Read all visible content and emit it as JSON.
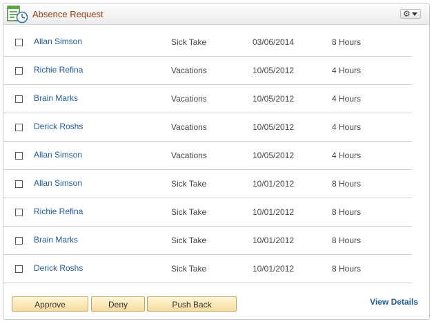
{
  "header": {
    "title": "Absence Request",
    "menu_icon": "gear-icon"
  },
  "rows": [
    {
      "name": "Allan Simson",
      "type": "Sick Take",
      "date": "03/06/2014",
      "hours": "8 Hours"
    },
    {
      "name": "Richie Refina",
      "type": "Vacations",
      "date": "10/05/2012",
      "hours": "4 Hours"
    },
    {
      "name": "Brain Marks",
      "type": "Vacations",
      "date": "10/05/2012",
      "hours": "4 Hours"
    },
    {
      "name": "Derick Roshs",
      "type": "Vacations",
      "date": "10/05/2012",
      "hours": "4 Hours"
    },
    {
      "name": "Allan Simson",
      "type": "Vacations",
      "date": "10/05/2012",
      "hours": "4 Hours"
    },
    {
      "name": "Allan Simson",
      "type": "Sick Take",
      "date": "10/01/2012",
      "hours": "8 Hours"
    },
    {
      "name": "Richie Refina",
      "type": "Sick Take",
      "date": "10/01/2012",
      "hours": "8 Hours"
    },
    {
      "name": "Brain Marks",
      "type": "Sick Take",
      "date": "10/01/2012",
      "hours": "8 Hours"
    },
    {
      "name": "Derick Roshs",
      "type": "Sick Take",
      "date": "10/01/2012",
      "hours": "8 Hours"
    }
  ],
  "actions": {
    "approve": "Approve",
    "deny": "Deny",
    "push_back": "Push Back",
    "view_details": "View Details"
  },
  "colors": {
    "title": "#9b3d12",
    "link": "#1f5ba6",
    "button_bg": "#f6dc9e"
  }
}
